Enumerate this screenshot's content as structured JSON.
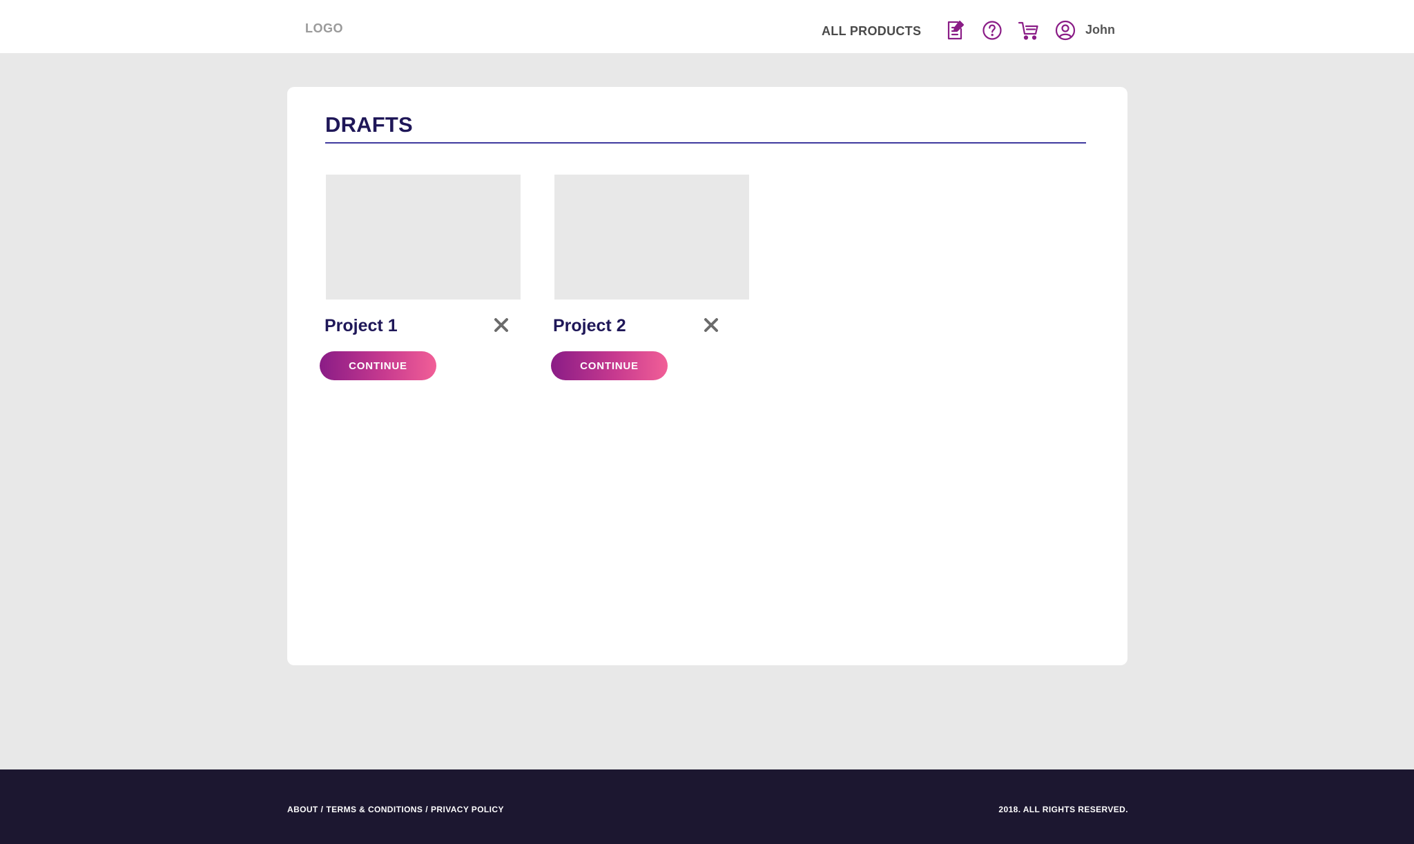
{
  "header": {
    "logo": "LOGO",
    "nav_all_products": "ALL PRODUCTS",
    "icons": [
      "edit-icon",
      "help-icon",
      "cart-icon",
      "user-icon"
    ],
    "username": "John"
  },
  "main": {
    "title": "DRAFTS",
    "projects": [
      {
        "name": "Project 1",
        "button_label": "CONTINUE"
      },
      {
        "name": "Project 2",
        "button_label": "CONTINUE"
      }
    ]
  },
  "footer": {
    "links": [
      "ABOUT",
      "TERMS & CONDITIONS",
      "PRIVACY POLICY"
    ],
    "separator": "/",
    "copyright": "2018. ALL RIGHTS RESERVED."
  },
  "colors": {
    "accent_purple": "#8a1c86",
    "accent_pink": "#f15f97",
    "title_navy": "#1f1758",
    "footer_bg": "#1c1730",
    "page_bg": "#e8e8e8"
  }
}
